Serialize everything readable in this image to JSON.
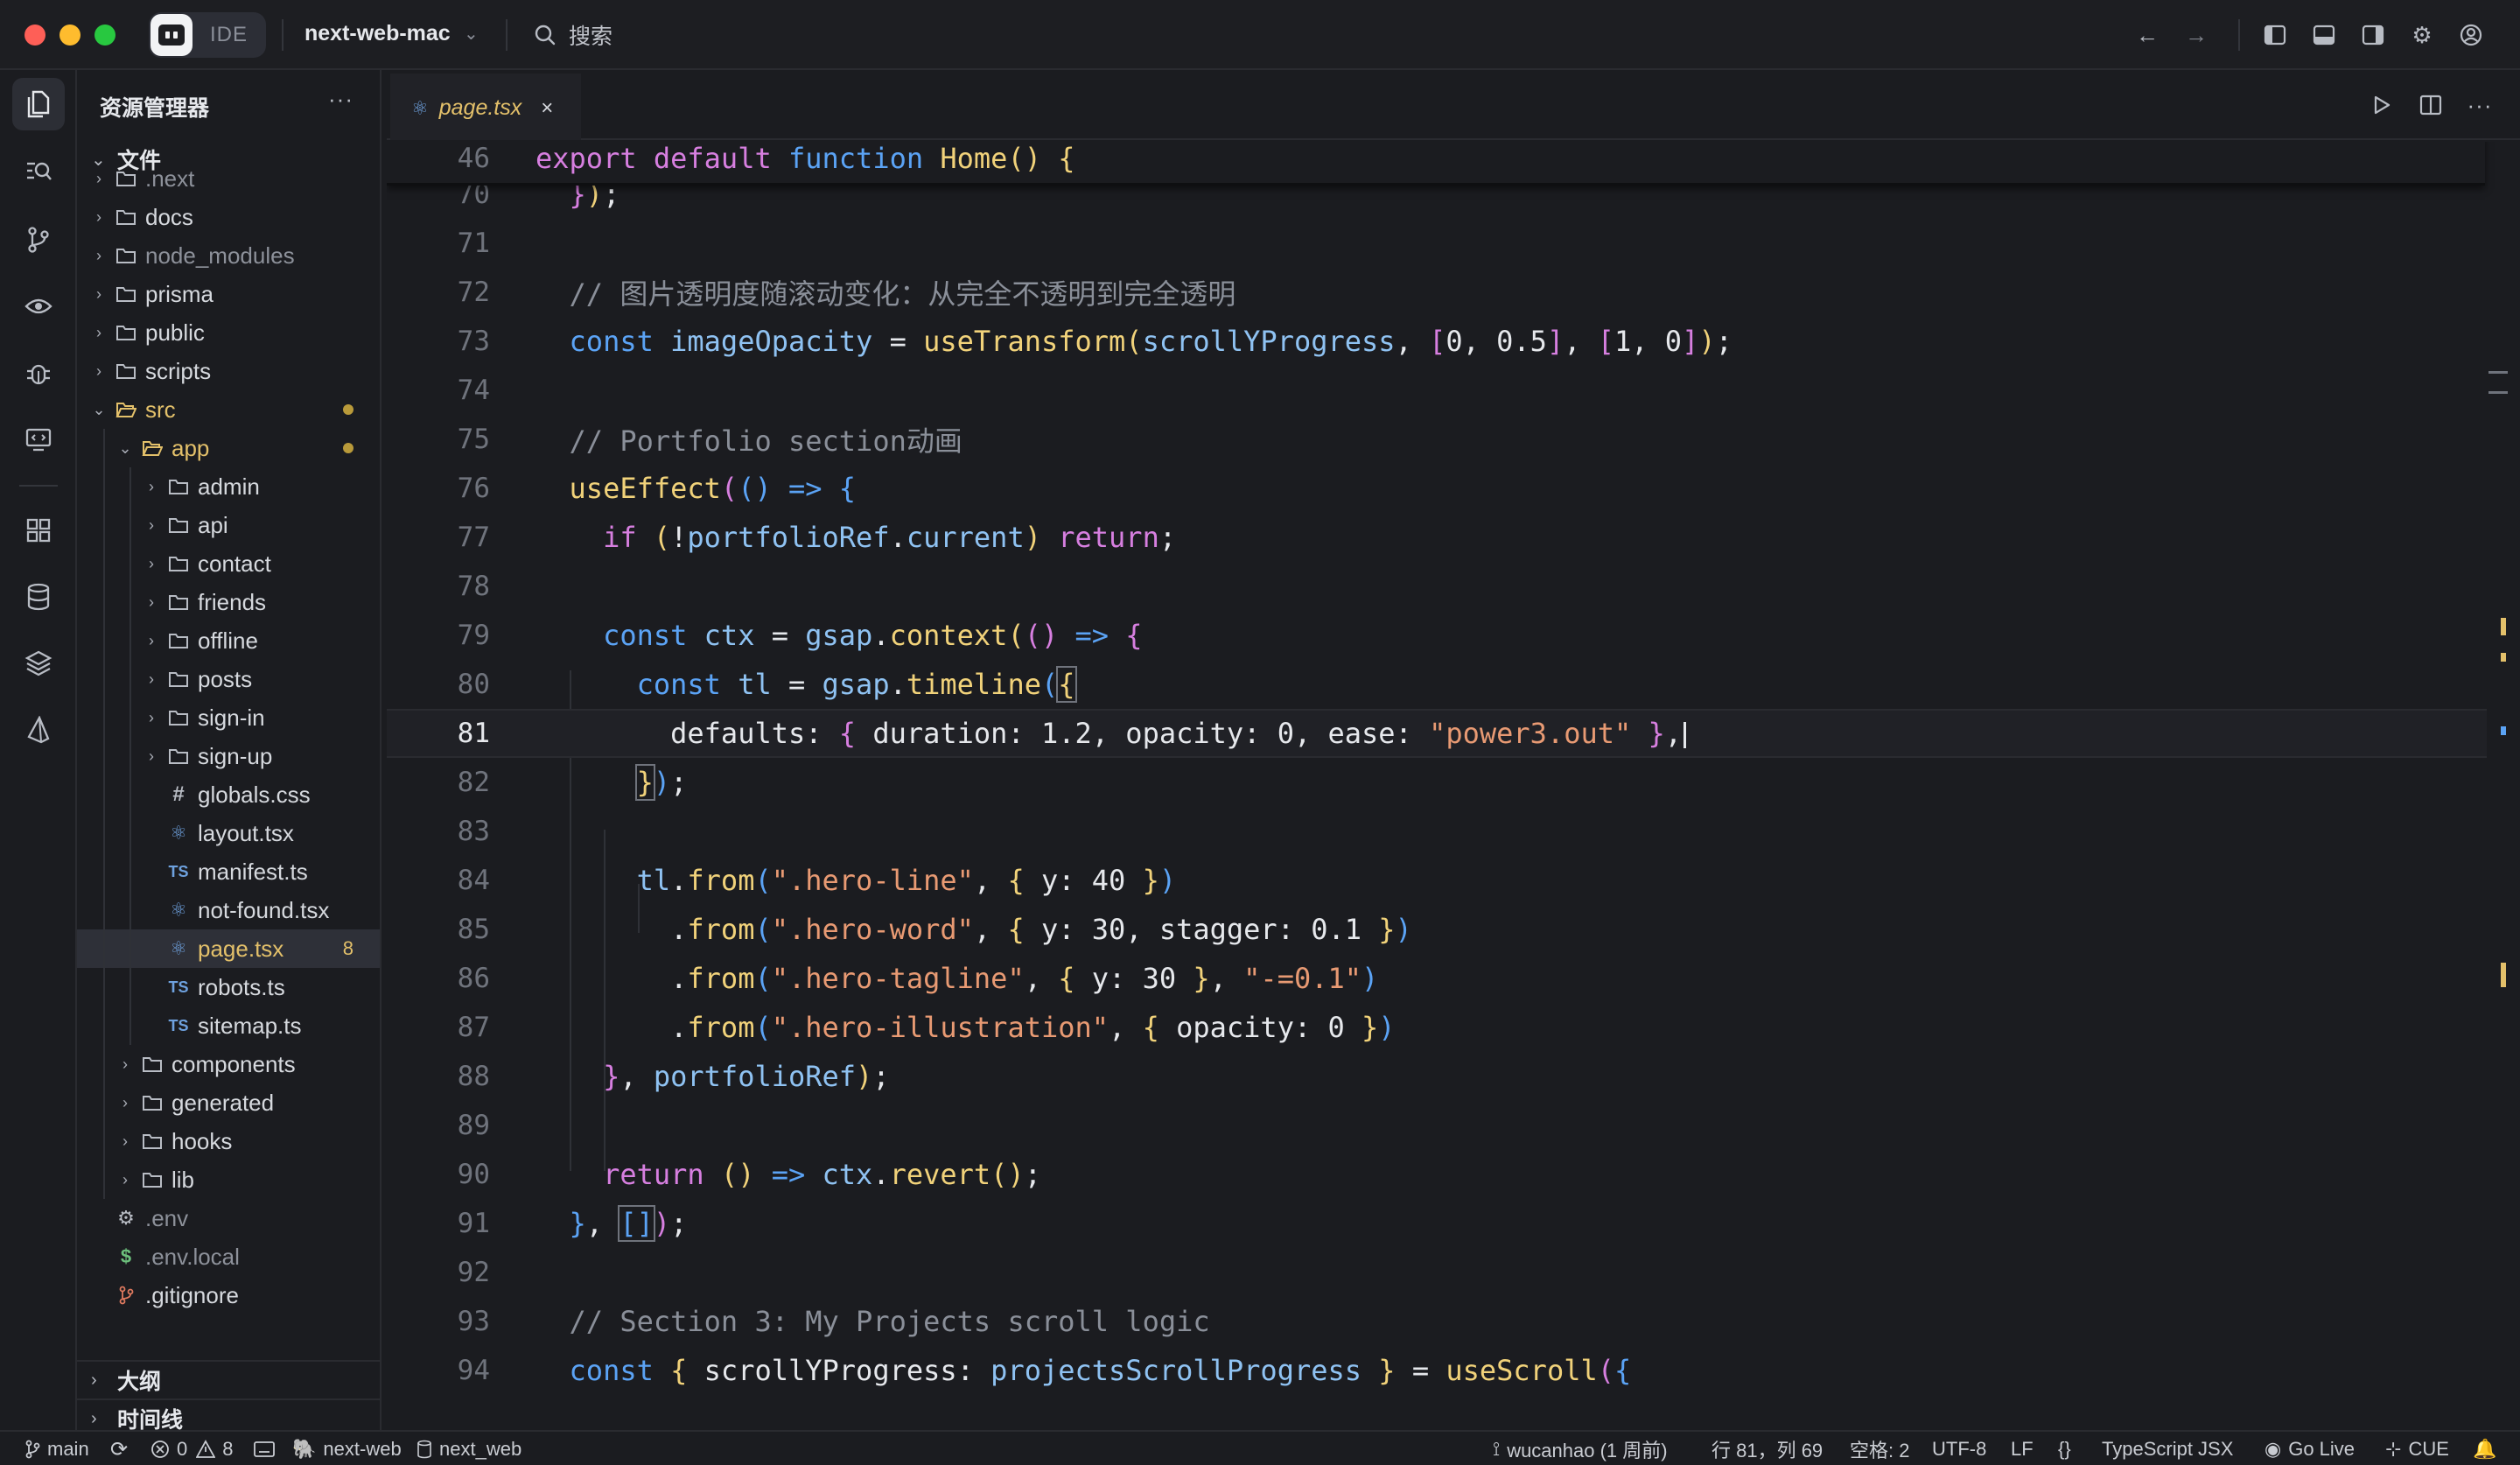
{
  "titlebar": {
    "ide_label": "IDE",
    "project_name": "next-web-mac",
    "search_label": "搜索"
  },
  "sidebar": {
    "title": "资源管理器",
    "files_section": "文件",
    "outline_section": "大纲",
    "timeline_section": "时间线",
    "tree": [
      {
        "name": ".next",
        "type": "folder",
        "depth": 0,
        "dim": true
      },
      {
        "name": "docs",
        "type": "folder",
        "depth": 0
      },
      {
        "name": "node_modules",
        "type": "folder",
        "depth": 0,
        "dim": true
      },
      {
        "name": "prisma",
        "type": "folder",
        "depth": 0
      },
      {
        "name": "public",
        "type": "folder",
        "depth": 0
      },
      {
        "name": "scripts",
        "type": "folder",
        "depth": 0
      },
      {
        "name": "src",
        "type": "folder-open",
        "depth": 0,
        "color": "yellow",
        "dot": true
      },
      {
        "name": "app",
        "type": "folder-open",
        "depth": 1,
        "color": "yellow",
        "dot": true
      },
      {
        "name": "admin",
        "type": "folder",
        "depth": 2
      },
      {
        "name": "api",
        "type": "folder",
        "depth": 2
      },
      {
        "name": "contact",
        "type": "folder",
        "depth": 2
      },
      {
        "name": "friends",
        "type": "folder",
        "depth": 2
      },
      {
        "name": "offline",
        "type": "folder",
        "depth": 2
      },
      {
        "name": "posts",
        "type": "folder",
        "depth": 2
      },
      {
        "name": "sign-in",
        "type": "folder",
        "depth": 2
      },
      {
        "name": "sign-up",
        "type": "folder",
        "depth": 2
      },
      {
        "name": "globals.css",
        "type": "css",
        "depth": 2
      },
      {
        "name": "layout.tsx",
        "type": "react",
        "depth": 2
      },
      {
        "name": "manifest.ts",
        "type": "ts",
        "depth": 2
      },
      {
        "name": "not-found.tsx",
        "type": "react",
        "depth": 2
      },
      {
        "name": "page.tsx",
        "type": "react",
        "depth": 2,
        "color": "yellow",
        "selected": true,
        "badge": "8"
      },
      {
        "name": "robots.ts",
        "type": "ts",
        "depth": 2
      },
      {
        "name": "sitemap.ts",
        "type": "ts",
        "depth": 2
      },
      {
        "name": "components",
        "type": "folder",
        "depth": 1
      },
      {
        "name": "generated",
        "type": "folder",
        "depth": 1
      },
      {
        "name": "hooks",
        "type": "folder",
        "depth": 1
      },
      {
        "name": "lib",
        "type": "folder",
        "depth": 1
      },
      {
        "name": ".env",
        "type": "gear",
        "depth": 0,
        "dim": true
      },
      {
        "name": ".env.local",
        "type": "dollar",
        "depth": 0,
        "dim": true
      },
      {
        "name": ".gitignore",
        "type": "git",
        "depth": 0
      }
    ]
  },
  "editor": {
    "tab_name": "page.tsx",
    "tab_close": "×",
    "sticky_line": "46",
    "current_line": "81"
  },
  "code_lines": [
    {
      "n": "70"
    },
    {
      "n": "71"
    },
    {
      "n": "72"
    },
    {
      "n": "73"
    },
    {
      "n": "74"
    },
    {
      "n": "75"
    },
    {
      "n": "76"
    },
    {
      "n": "77"
    },
    {
      "n": "78"
    },
    {
      "n": "79"
    },
    {
      "n": "80"
    },
    {
      "n": "81"
    },
    {
      "n": "82"
    },
    {
      "n": "83"
    },
    {
      "n": "84"
    },
    {
      "n": "85"
    },
    {
      "n": "86"
    },
    {
      "n": "87"
    },
    {
      "n": "88"
    },
    {
      "n": "89"
    },
    {
      "n": "90"
    },
    {
      "n": "91"
    },
    {
      "n": "92"
    },
    {
      "n": "93"
    },
    {
      "n": "94"
    }
  ],
  "code_text": {
    "sticky": [
      "export",
      "default",
      "function",
      "Home",
      "()",
      "{"
    ],
    "l72_comment": "// 图片透明度随滚动变化：从完全不透明到完全透明",
    "l75_comment": "// Portfolio section动画",
    "l93_comment": "// Section 3: My Projects scroll logic",
    "s_power3": "\"power3.out\"",
    "s_hero_line": "\".hero-line\"",
    "s_hero_word": "\".hero-word\"",
    "s_hero_tagline": "\".hero-tagline\"",
    "s_offset": "\"-=0.1\"",
    "s_hero_illus": "\".hero-illustration\""
  },
  "statusbar": {
    "branch": "main",
    "errors": "0",
    "warnings": "8",
    "remote": "next-web",
    "db": "next_web",
    "blame": "wucanhao (1 周前)",
    "position": "行 81，列 69",
    "spaces": "空格: 2",
    "encoding": "UTF-8",
    "eol": "LF",
    "braces": "{}",
    "language": "TypeScript JSX",
    "go_live": "Go Live",
    "cue": "CUE"
  },
  "colors": {
    "accent_yellow": "#e3c06a",
    "keyword": "#5ba3f5",
    "string": "#e89a73",
    "comment": "#8a8f99",
    "function": "#f1d27a"
  }
}
